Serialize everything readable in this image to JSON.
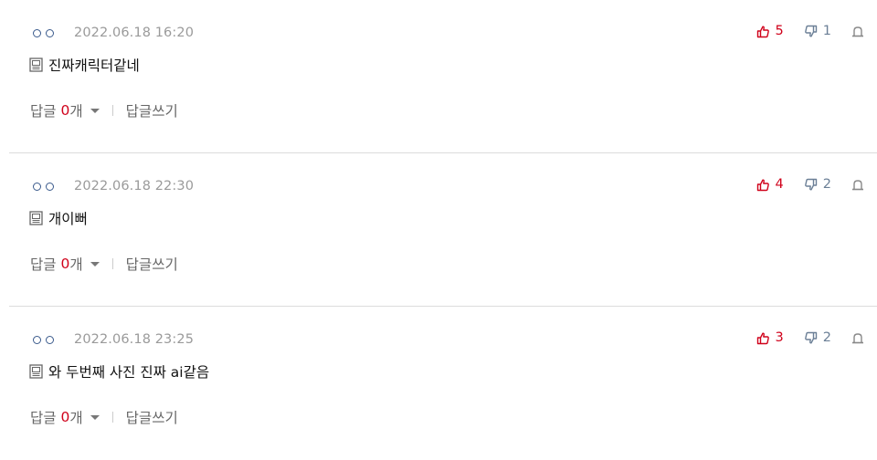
{
  "comments": [
    {
      "author": "○○",
      "date": "2022.06.18 16:20",
      "likes": "5",
      "dislikes": "1",
      "text": "진짜캐릭터같네",
      "reply_label": "답글",
      "reply_count": "0",
      "reply_unit": "개",
      "write_label": "답글쓰기"
    },
    {
      "author": "○○",
      "date": "2022.06.18 22:30",
      "likes": "4",
      "dislikes": "2",
      "text": "개이뻐",
      "reply_label": "답글",
      "reply_count": "0",
      "reply_unit": "개",
      "write_label": "답글쓰기"
    },
    {
      "author": "○○",
      "date": "2022.06.18 23:25",
      "likes": "3",
      "dislikes": "2",
      "text": "와 두번째 사진 진짜 ai같음",
      "reply_label": "답글",
      "reply_count": "0",
      "reply_unit": "개",
      "write_label": "답글쓰기"
    }
  ],
  "icons": {
    "like": "thumbs-up-icon",
    "dislike": "thumbs-down-icon",
    "report": "report-icon",
    "text": "document-icon",
    "toggle": "caret-down-icon"
  },
  "colors": {
    "like": "#d0021b",
    "dislike": "#6b7f96",
    "author": "#3a5a8c",
    "reply_count": "#d0021b"
  }
}
